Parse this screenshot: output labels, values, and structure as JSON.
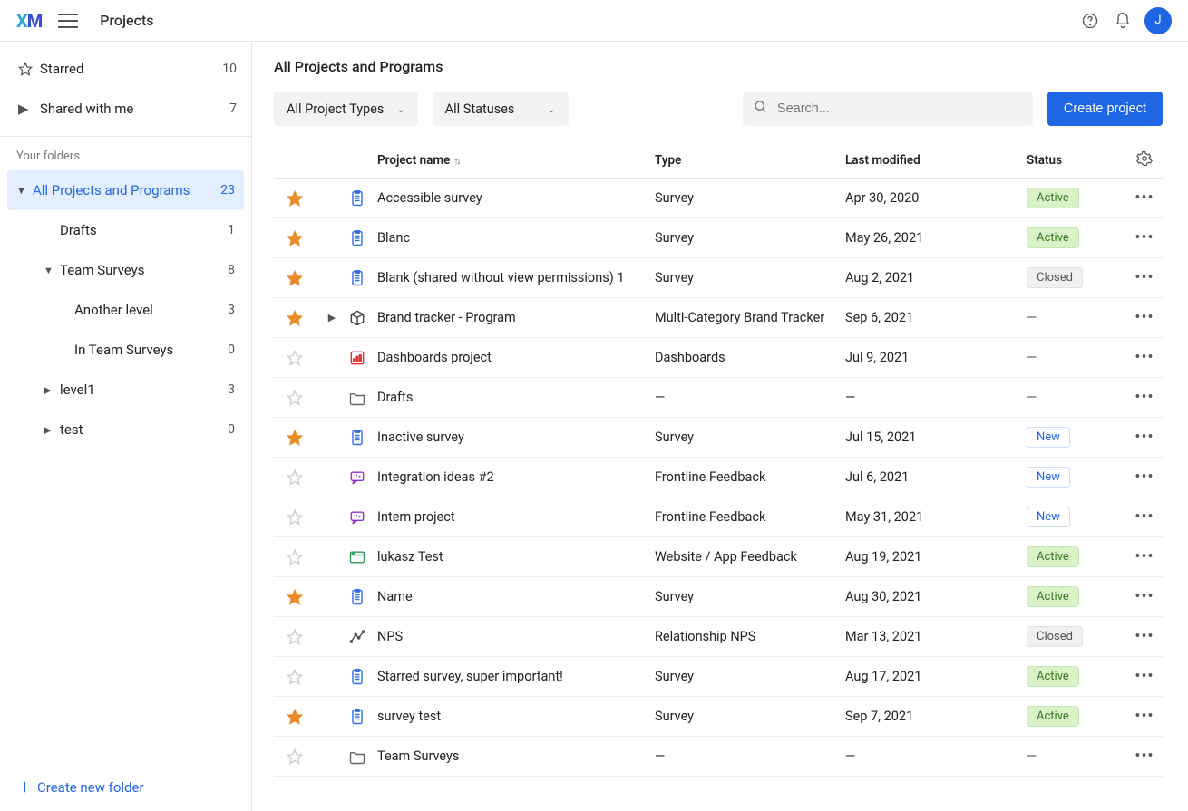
{
  "header": {
    "app": "Projects",
    "avatar_initial": "J"
  },
  "sidebar": {
    "starred_label": "Starred",
    "starred_count": "10",
    "shared_label": "Shared with me",
    "shared_count": "7",
    "section_label": "Your folders",
    "create_folder": "Create new folder",
    "folders": [
      {
        "label": "All Projects and Programs",
        "count": "23",
        "depth": 0,
        "selected": true,
        "expanded": true
      },
      {
        "label": "Drafts",
        "count": "1",
        "depth": 1,
        "selected": false
      },
      {
        "label": "Team Surveys",
        "count": "8",
        "depth": 1,
        "selected": false,
        "expanded": true
      },
      {
        "label": "Another level",
        "count": "3",
        "depth": 2,
        "selected": false
      },
      {
        "label": "In Team Surveys",
        "count": "0",
        "depth": 2,
        "selected": false
      },
      {
        "label": "level1",
        "count": "3",
        "depth": 1,
        "selected": false,
        "collapsed": true
      },
      {
        "label": "test",
        "count": "0",
        "depth": 1,
        "selected": false,
        "collapsed": true
      }
    ]
  },
  "page": {
    "heading": "All Projects and Programs",
    "filter_type": "All Project Types",
    "filter_status": "All Statuses",
    "search_placeholder": "Search...",
    "create_btn": "Create project",
    "col_name": "Project name",
    "col_type": "Type",
    "col_mod": "Last modified",
    "col_status": "Status"
  },
  "statuses": {
    "active": "Active",
    "closed": "Closed",
    "new": "New",
    "dash": "—"
  },
  "projects": [
    {
      "name": "Accessible survey",
      "type": "Survey",
      "modified": "Apr 30, 2020",
      "status": "active",
      "starred": true,
      "icon": "survey"
    },
    {
      "name": "Blanc",
      "type": "Survey",
      "modified": "May 26, 2021",
      "status": "active",
      "starred": true,
      "icon": "survey"
    },
    {
      "name": "Blank (shared without view permissions) 1",
      "type": "Survey",
      "modified": "Aug 2, 2021",
      "status": "closed",
      "starred": true,
      "icon": "survey"
    },
    {
      "name": "Brand tracker - Program",
      "type": "Multi-Category Brand Tracker",
      "modified": "Sep 6, 2021",
      "status": "dash",
      "starred": true,
      "icon": "program",
      "expandable": true
    },
    {
      "name": "Dashboards project",
      "type": "Dashboards",
      "modified": "Jul 9, 2021",
      "status": "dash",
      "starred": false,
      "icon": "dashboard"
    },
    {
      "name": "Drafts",
      "type": "—",
      "modified": "—",
      "status": "dash",
      "starred": false,
      "icon": "folder"
    },
    {
      "name": "Inactive survey",
      "type": "Survey",
      "modified": "Jul 15, 2021",
      "status": "new",
      "starred": true,
      "icon": "survey"
    },
    {
      "name": "Integration ideas #2",
      "type": "Frontline Feedback",
      "modified": "Jul 6, 2021",
      "status": "new",
      "starred": false,
      "icon": "feedback"
    },
    {
      "name": "Intern project",
      "type": "Frontline Feedback",
      "modified": "May 31, 2021",
      "status": "new",
      "starred": false,
      "icon": "feedback"
    },
    {
      "name": "lukasz Test",
      "type": "Website / App Feedback",
      "modified": "Aug 19, 2021",
      "status": "active",
      "starred": false,
      "icon": "website"
    },
    {
      "name": "Name",
      "type": "Survey",
      "modified": "Aug 30, 2021",
      "status": "active",
      "starred": true,
      "icon": "survey"
    },
    {
      "name": "NPS",
      "type": "Relationship NPS",
      "modified": "Mar 13, 2021",
      "status": "closed",
      "starred": false,
      "icon": "nps"
    },
    {
      "name": "Starred survey, super important!",
      "type": "Survey",
      "modified": "Aug 17, 2021",
      "status": "active",
      "starred": false,
      "icon": "survey"
    },
    {
      "name": "survey test",
      "type": "Survey",
      "modified": "Sep 7, 2021",
      "status": "active",
      "starred": true,
      "icon": "survey"
    },
    {
      "name": "Team Surveys",
      "type": "—",
      "modified": "—",
      "status": "dash",
      "starred": false,
      "icon": "folder"
    }
  ]
}
